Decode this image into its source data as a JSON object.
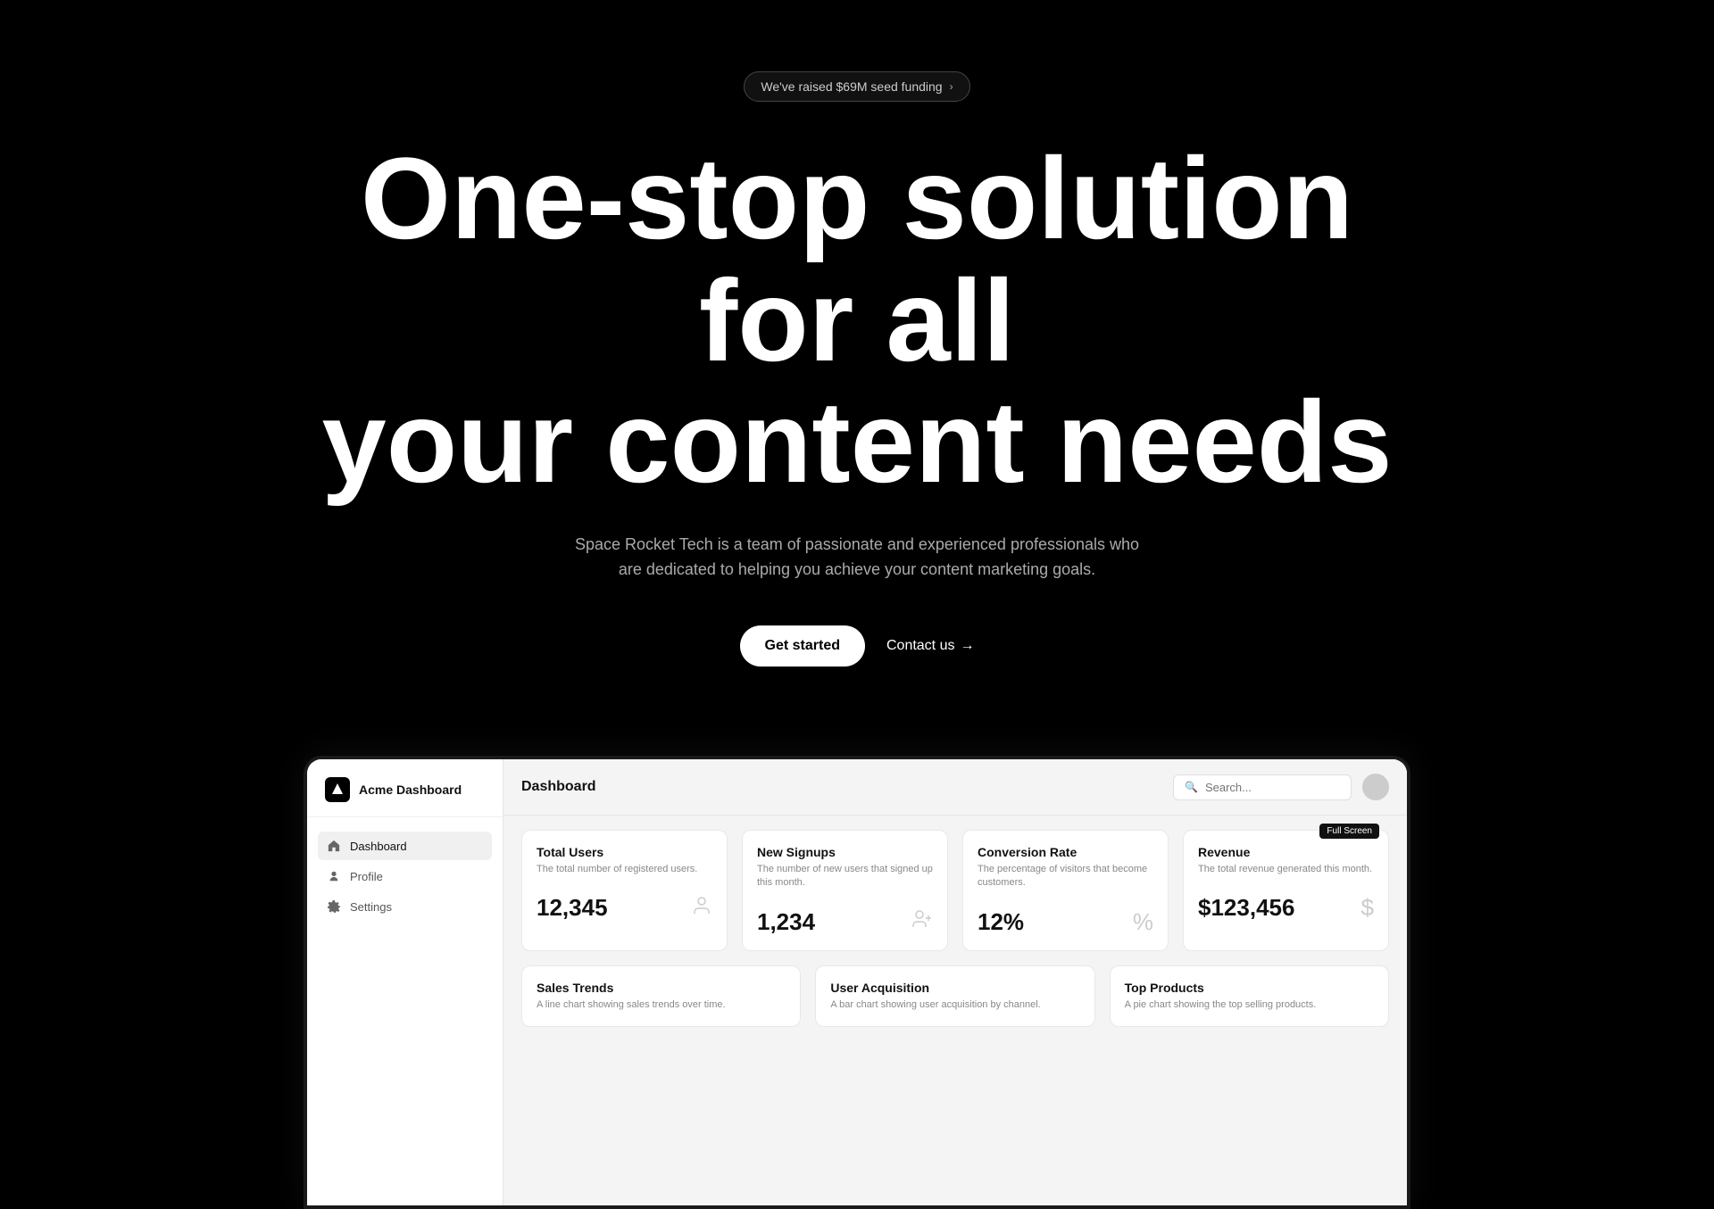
{
  "hero": {
    "badge_text": "We've raised $69M seed funding",
    "badge_chevron": "›",
    "title_line1": "One-stop solution for all",
    "title_line2": "your content needs",
    "subtitle": "Space Rocket Tech is a team of passionate and experienced professionals who are dedicated to helping you achieve your content marketing goals.",
    "btn_primary": "Get started",
    "btn_secondary": "Contact us",
    "btn_secondary_arrow": "→"
  },
  "sidebar": {
    "logo_text": "Acme Dashboard",
    "nav_items": [
      {
        "id": "dashboard",
        "label": "Dashboard",
        "icon": "⌂",
        "active": true
      },
      {
        "id": "profile",
        "label": "Profile",
        "icon": "○",
        "active": false
      },
      {
        "id": "settings",
        "label": "Settings",
        "icon": "⚙",
        "active": false
      }
    ]
  },
  "main": {
    "title": "Dashboard",
    "search_placeholder": "Search...",
    "full_screen_badge": "Full Screen"
  },
  "stats": [
    {
      "id": "total-users",
      "label": "Total Users",
      "desc": "The total number of registered users.",
      "value": "12,345",
      "icon": "👤"
    },
    {
      "id": "new-signups",
      "label": "New Signups",
      "desc": "The number of new users that signed up this month.",
      "value": "1,234",
      "icon": "👥"
    },
    {
      "id": "conversion-rate",
      "label": "Conversion Rate",
      "desc": "The percentage of visitors that become customers.",
      "value": "12%",
      "icon": "%"
    },
    {
      "id": "revenue",
      "label": "Revenue",
      "desc": "The total revenue generated this month.",
      "value": "$123,456",
      "icon": "$",
      "badge": "Full Screen"
    }
  ],
  "bottom_cards": [
    {
      "id": "sales-trends",
      "title": "Sales Trends",
      "desc": "A line chart showing sales trends over time."
    },
    {
      "id": "user-acquisition",
      "title": "User Acquisition",
      "desc": "A bar chart showing user acquisition by channel."
    },
    {
      "id": "top-products",
      "title": "Top Products",
      "desc": "A pie chart showing the top selling products."
    }
  ]
}
